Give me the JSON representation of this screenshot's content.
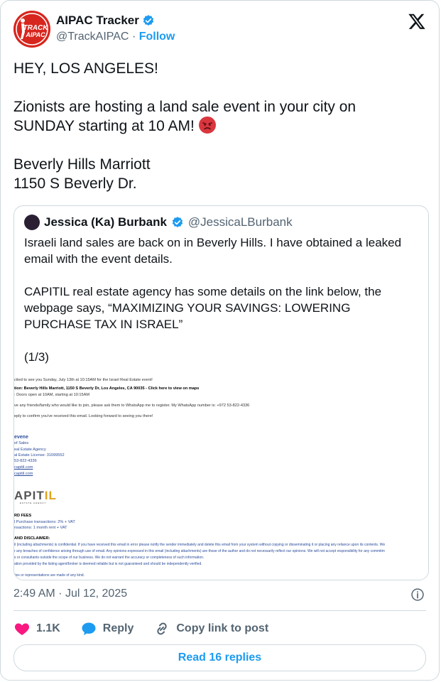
{
  "author": {
    "name": "AIPAC Tracker",
    "handle": "@TrackAIPAC",
    "separator": "·",
    "follow_label": "Follow",
    "avatar_text_1": "TRACK",
    "avatar_text_2": "AIPAC"
  },
  "tweet": {
    "text": "HEY, LOS ANGELES!\n\nZionists are hosting a land sale event in your city on SUNDAY starting at 10 AM! ",
    "text_after_emoji": "\n\nBeverly Hills Marriott\n1150 S Beverly Dr.",
    "emoji": "angry-face-icon"
  },
  "quoted": {
    "name": "Jessica (Ka) Burbank",
    "handle": "@JessicaLBurbank",
    "text": "Israeli land sales are back on in Beverly Hills. I have obtained a leaked email with the event details.\n\nCAPITIL real estate agency has some details on the link below, the webpage says, “MAXIMIZING YOUR SAVINGS: LOWERING PURCHASE TAX IN ISRAEL”\n\n(1/3)",
    "image": {
      "lines": [
        "cited to see you Sunday, July 13th at 10:15AM for the Israel Real Estate event!",
        "tion: Beverly Hills Marriott, 1150 S Beverly Dr, Los Angeles, CA 90035 - Click here to view on maps",
        ": Doors open at 10AM, starting at 10:15AM",
        "ve any friends/family who would like to join, please ask them to WhatsApp me to register. My WhatsApp number is: +972 53-822-4336",
        "eply to confirm you've received this email. Looking forward to seeing you there!",
        "evene",
        "of Sales",
        "eal Estate Agency",
        "al Estate License: 31099552",
        "53-822-4336",
        "capitil.com",
        "capitil.com",
        "RD FEES",
        "l Purchase transactions: 2% + VAT",
        "nsactions: 1 month rent + VAT",
        "AND DISCLAIMER:",
        "il (including attachments) is confidential. If you have received this email in error please notify the sender immediately and delete this email from your system without copying or disseminating it or placing any reliance upon its contents. We",
        "r any breaches of confidence arising through use of email. Any opinions expressed in this email (including attachments) are those of the author and do not necessarily reflect our opinions. We will not accept responsibility for any commitm",
        "s or consultants outside the scope of our business. We do not warrant the accuracy or completeness of such information.",
        "ation provided by the listing agent/broker is deemed reliable but is not guaranteed and should be independently verified.",
        "ties or representations are made of any kind."
      ],
      "logo_main": "APIT",
      "logo_accent": "IL",
      "logo_sub": "ESTATE AGENCY"
    }
  },
  "meta": {
    "time": "2:49 AM",
    "separator": "·",
    "date": "Jul 12, 2025"
  },
  "actions": {
    "likes": "1.1K",
    "reply_label": "Reply",
    "copy_label": "Copy link to post"
  },
  "replies_button": "Read 16 replies",
  "colors": {
    "brand_blue": "#1d9bf0",
    "heart": "#f91880",
    "avatar_red": "#d7261e"
  }
}
